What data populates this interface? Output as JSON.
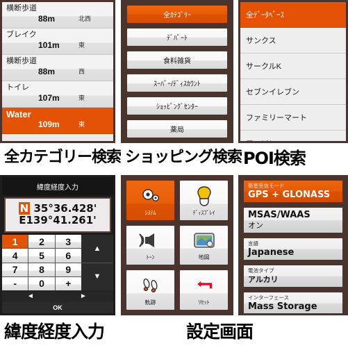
{
  "colors": {
    "accent": "#e35205",
    "frame": "#4a342e",
    "screen": "#e9e9e9"
  },
  "captions": {
    "all_category_search": "全カテゴリー検索",
    "shopping_search": "ショッピング検索",
    "poi_search": "POI検索",
    "latlon_input": "緯度経度入力",
    "settings_screen": "設定画面"
  },
  "proximity_list": {
    "rows": [
      {
        "name": "横断歩道",
        "distance": "88m",
        "direction": "北西",
        "selected": false
      },
      {
        "name": "ブレイク",
        "distance": "101m",
        "direction": "東",
        "selected": false
      },
      {
        "name": "横断歩道",
        "distance": "88m",
        "direction": "西",
        "selected": false
      },
      {
        "name": "トイレ",
        "distance": "107m",
        "direction": "東",
        "selected": false
      },
      {
        "name": "Water",
        "distance": "109m",
        "direction": "東",
        "selected": true
      }
    ]
  },
  "shopping_categories": {
    "buttons": [
      {
        "label": "全ｶﾃｺﾞﾘｰ",
        "selected": true
      },
      {
        "label": "ﾃﾞﾊﾟｰﾄ",
        "selected": false
      },
      {
        "label": "食料雑貨",
        "selected": false
      },
      {
        "label": "ｽｰﾊﾟｰ/ﾃﾞｨｽｶｳﾝﾄ",
        "selected": false
      },
      {
        "label": "ｼｮｯﾋﾟﾝｸﾞｾﾝﾀｰ",
        "selected": false
      },
      {
        "label": "薬局",
        "selected": false
      }
    ]
  },
  "poi_database": {
    "rows": [
      {
        "label": "全ﾃﾞｰﾀﾍﾞｰｽ",
        "selected": true
      },
      {
        "label": "サンクス",
        "selected": false
      },
      {
        "label": "サークルK",
        "selected": false
      },
      {
        "label": "セブンイレブン",
        "selected": false
      },
      {
        "label": "ファミリーマート",
        "selected": false
      },
      {
        "label": "ローソン",
        "selected": false
      }
    ]
  },
  "latlon": {
    "title": "緯度経度入力",
    "cursor_char": "N",
    "lat_rest": " 35°36.428'",
    "lon": "E139°41.261'",
    "keys": [
      {
        "label": "1",
        "selected": true
      },
      {
        "label": "2",
        "selected": false
      },
      {
        "label": "3",
        "selected": false
      },
      {
        "label": "4",
        "selected": false
      },
      {
        "label": "5",
        "selected": false
      },
      {
        "label": "6",
        "selected": false
      },
      {
        "label": "7",
        "selected": false
      },
      {
        "label": "8",
        "selected": false
      },
      {
        "label": "9",
        "selected": false
      },
      {
        "label": "-",
        "selected": false
      },
      {
        "label": "0",
        "selected": false
      },
      {
        "label": "+",
        "selected": false
      }
    ],
    "arrow_up": "▲",
    "arrow_down": "▼",
    "arrow_left": "◄",
    "arrow_right": "►",
    "ok_label": "OK"
  },
  "settings_grid": {
    "cells": [
      {
        "label": "ｼｽﾃﾑ",
        "icon": "gears-icon",
        "selected": true
      },
      {
        "label": "ﾃﾞｨｽﾌﾟﾚｲ",
        "icon": "lightbulb-icon",
        "selected": false
      },
      {
        "label": "ﾄｰﾝ",
        "icon": "speaker-icon",
        "selected": false
      },
      {
        "label": "地図",
        "icon": "map-icon",
        "selected": false
      },
      {
        "label": "軌跡",
        "icon": "footprints-icon",
        "selected": false
      },
      {
        "label": "ﾘｾｯﾄ",
        "icon": "reset-arrow-icon",
        "selected": false
      }
    ]
  },
  "settings_list": {
    "rows": [
      {
        "label": "衛星受信モード",
        "value": "GPS + GLONASS",
        "selected": true,
        "jp": false
      },
      {
        "label": "",
        "value": "MSAS/WAAS",
        "value2": "オン",
        "selected": false,
        "jp": false
      },
      {
        "label": "言語",
        "value": "Japanese",
        "selected": false,
        "jp": false
      },
      {
        "label": "電池タイプ",
        "value": "アルカリ",
        "selected": false,
        "jp": true
      },
      {
        "label": "インターフェース",
        "value": "Mass Storage",
        "selected": false,
        "jp": false
      }
    ]
  }
}
